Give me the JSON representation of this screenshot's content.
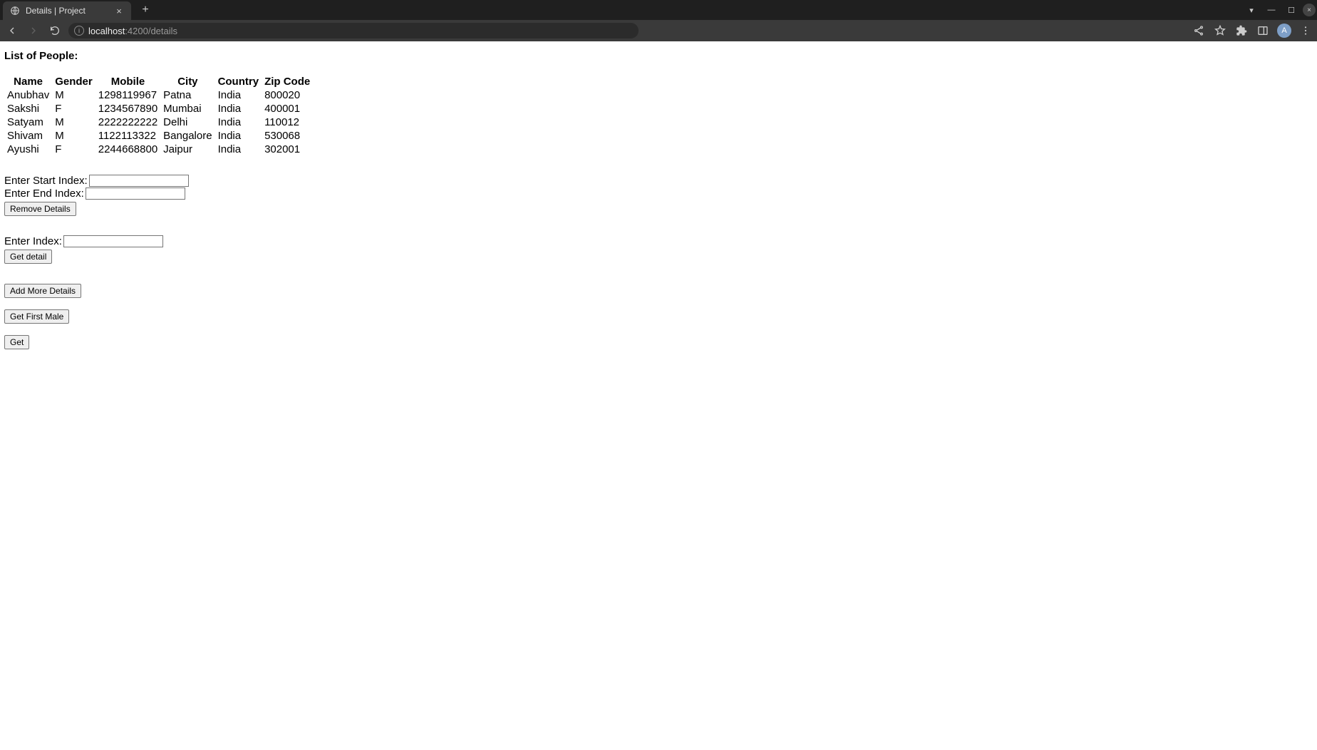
{
  "browser": {
    "tab_title": "Details | Project",
    "url_host": "localhost",
    "url_port_path": ":4200/details",
    "avatar_letter": "A"
  },
  "page": {
    "heading": "List of People:",
    "table": {
      "headers": [
        "Name",
        "Gender",
        "Mobile",
        "City",
        "Country",
        "Zip Code"
      ],
      "rows": [
        {
          "name": "Anubhav",
          "gender": "M",
          "mobile": "1298119967",
          "city": "Patna",
          "country": "India",
          "zip": "800020"
        },
        {
          "name": "Sakshi",
          "gender": "F",
          "mobile": "1234567890",
          "city": "Mumbai",
          "country": "India",
          "zip": "400001"
        },
        {
          "name": "Satyam",
          "gender": "M",
          "mobile": "2222222222",
          "city": "Delhi",
          "country": "India",
          "zip": "110012"
        },
        {
          "name": "Shivam",
          "gender": "M",
          "mobile": "1122113322",
          "city": "Bangalore",
          "country": "India",
          "zip": "530068"
        },
        {
          "name": "Ayushi",
          "gender": "F",
          "mobile": "2244668800",
          "city": "Jaipur",
          "country": "India",
          "zip": "302001"
        }
      ]
    },
    "form_remove": {
      "start_label": "Enter Start Index:",
      "end_label": "Enter End Index:",
      "button_label": "Remove Details"
    },
    "form_get": {
      "index_label": "Enter Index:",
      "button_label": "Get detail"
    },
    "buttons": {
      "add_more": "Add More Details",
      "get_first_male": "Get First Male",
      "get": "Get"
    }
  }
}
